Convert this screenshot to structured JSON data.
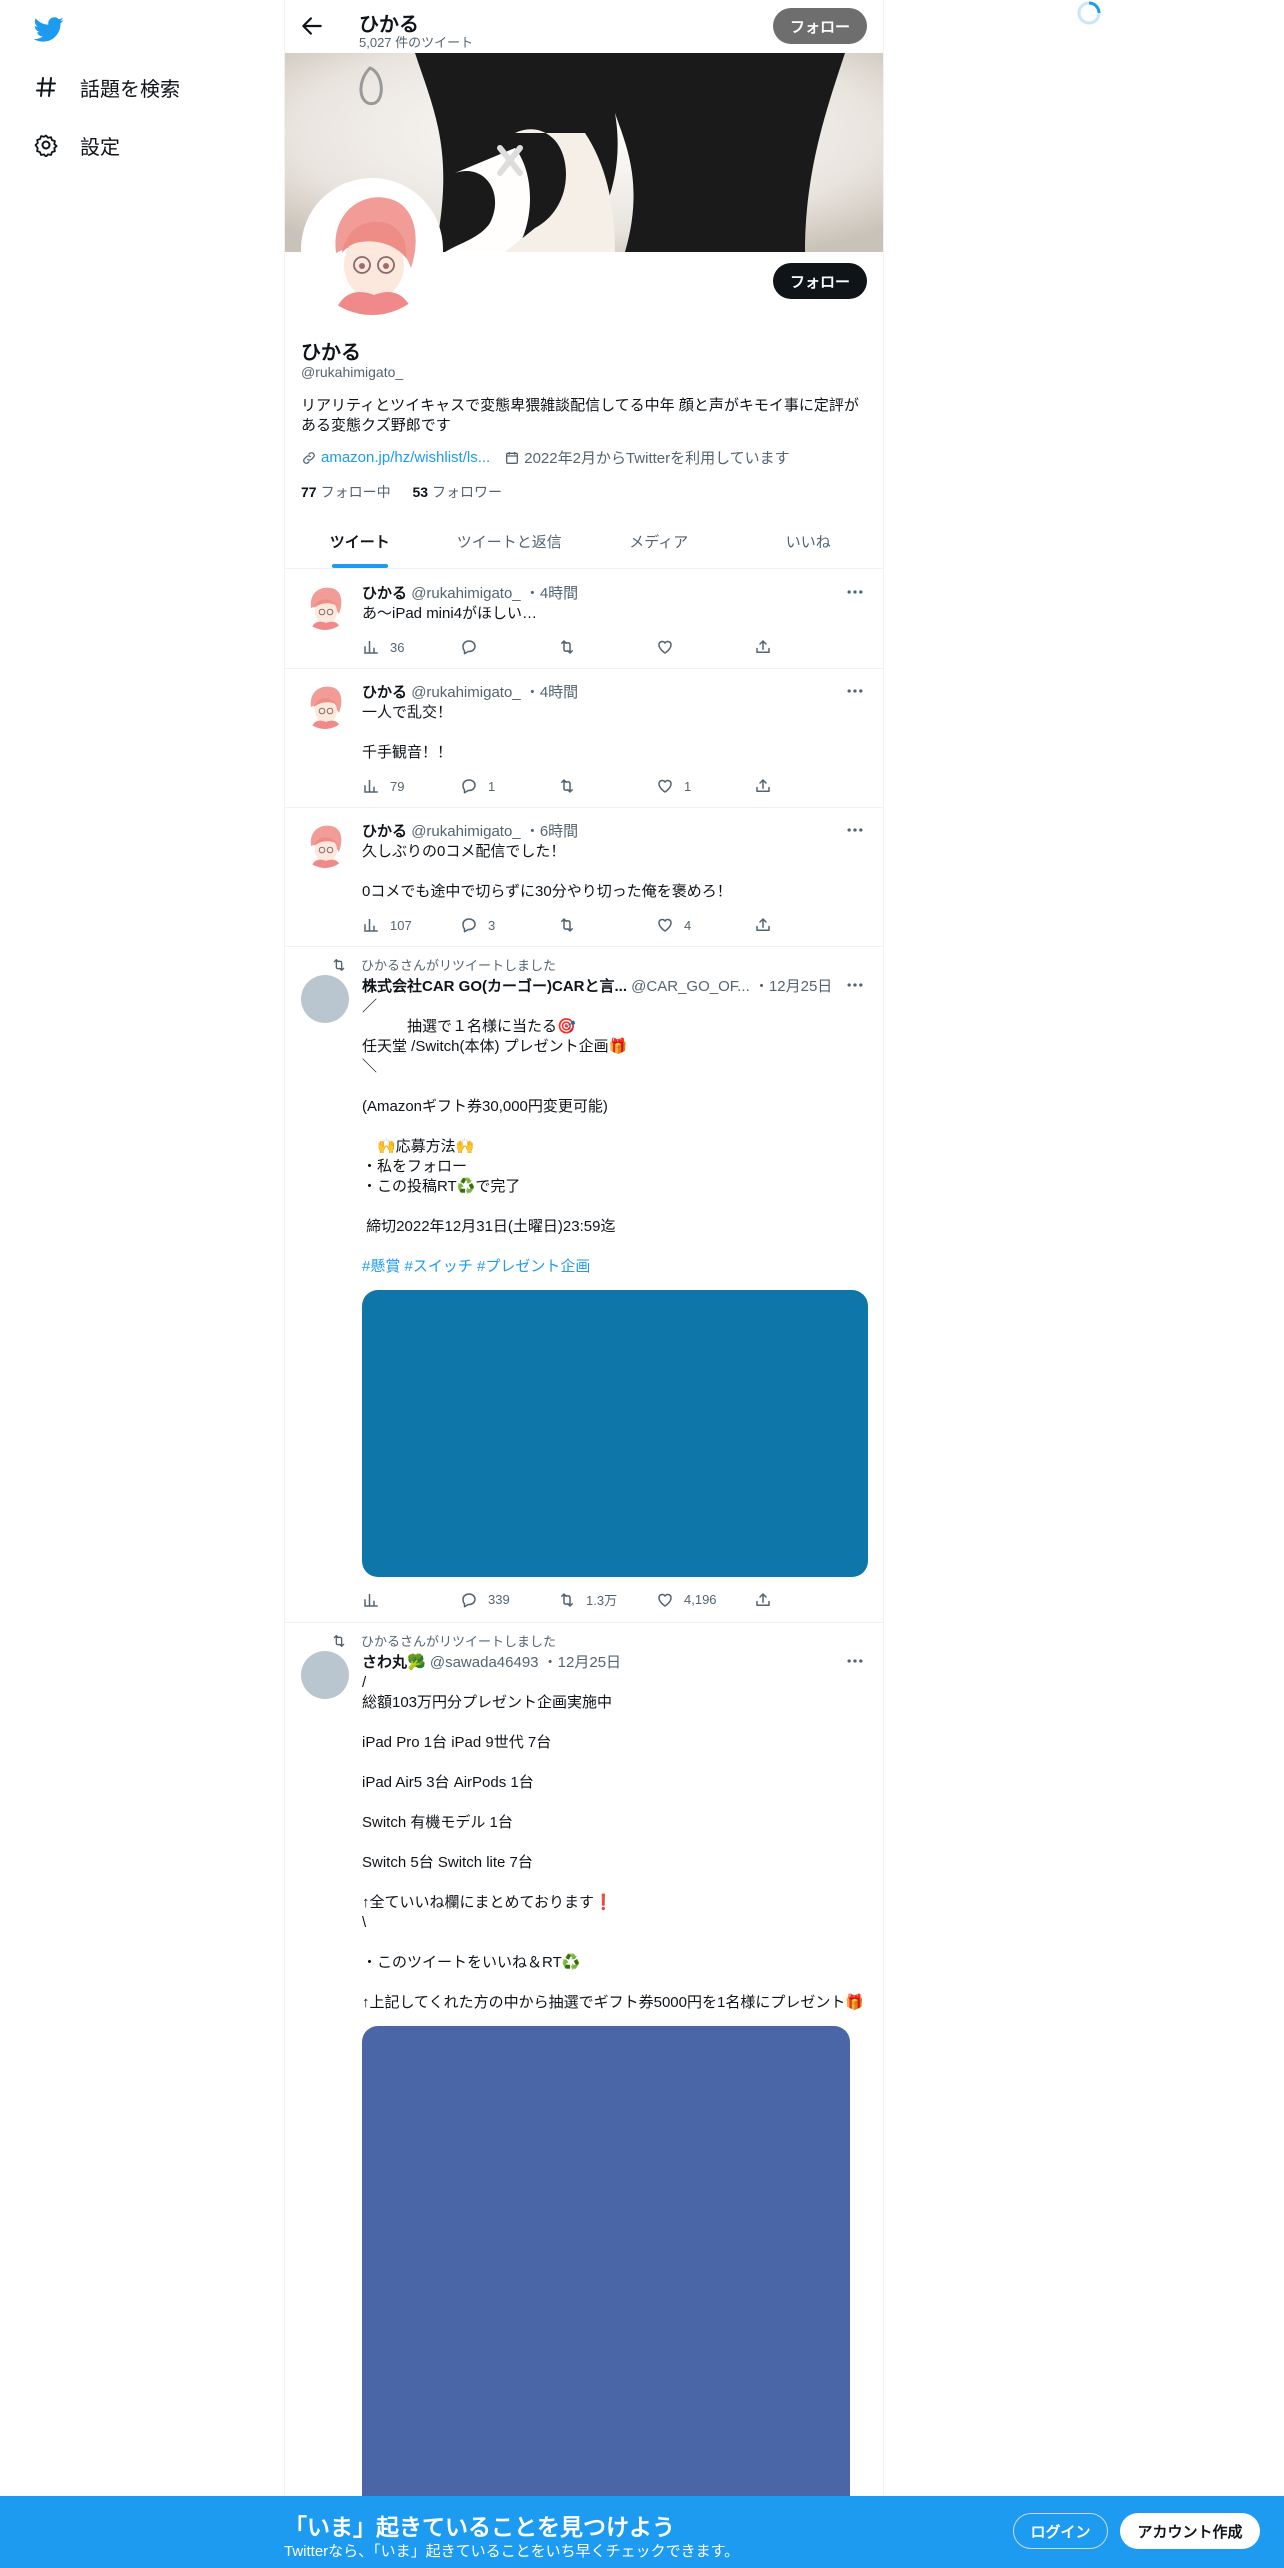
{
  "sidebar": {
    "logo": "twitter-bird-icon",
    "items": [
      {
        "label": "話題を検索",
        "icon": "hash-icon"
      },
      {
        "label": "設定",
        "icon": "gear-icon"
      }
    ]
  },
  "header": {
    "name": "ひかる",
    "tweet_count": "5,027 件のツイート",
    "follow": "フォロー"
  },
  "profile": {
    "follow": "フォロー",
    "name": "ひかる",
    "handle": "@rukahimigato_",
    "bio": "リアリティとツイキャスで変態卑猥雑談配信してる中年 顔と声がキモイ事に定評がある変態クズ野郎です",
    "link": "amazon.jp/hz/wishlist/ls...",
    "joined": "2022年2月からTwitterを利用しています",
    "following_count": "77",
    "following_label": "フォロー中",
    "followers_count": "53",
    "followers_label": "フォロワー"
  },
  "tabs": [
    "ツイート",
    "ツイートと返信",
    "メディア",
    "いいね"
  ],
  "tweets": [
    {
      "name": "ひかる",
      "handle": "@rukahimigato_",
      "time": "・4時間",
      "text": "あ〜iPad mini4がほしい…",
      "views": "36",
      "replies": "",
      "retweets": "",
      "likes": ""
    },
    {
      "name": "ひかる",
      "handle": "@rukahimigato_",
      "time": "・4時間",
      "text": "一人で乱交！\n\n千手観音！！",
      "views": "79",
      "replies": "1",
      "retweets": "",
      "likes": "1"
    },
    {
      "name": "ひかる",
      "handle": "@rukahimigato_",
      "time": "・6時間",
      "text": "久しぶりの0コメ配信でした！\n\n0コメでも途中で切らずに30分やり切った俺を褒めろ！",
      "views": "107",
      "replies": "3",
      "retweets": "",
      "likes": "4"
    },
    {
      "retweeted_by": "ひかるさんがリツイートしました",
      "name": "株式会社CAR GO(カーゴー)CARと言...",
      "handle": "@CAR_GO_OF...",
      "time": "・12月25日",
      "text": "／\n　　　抽選で１名様に当たる🎯\n任天堂 /Switch(本体) プレゼント企画🎁\n＼\n\n(Amazonギフト券30,000円変更可能)\n\n　🙌応募方法🙌\n・私をフォロー\n・この投稿RT♻️で完了\n\n 締切2022年12月31日(土曜日)23:59迄",
      "hashtags": "#懸賞 #スイッチ #プレゼント企画",
      "media_color": "#0e76a8",
      "views": "",
      "replies": "339",
      "retweets": "1.3万",
      "likes": "4,196"
    },
    {
      "retweeted_by": "ひかるさんがリツイートしました",
      "name": "さわ丸🥦",
      "handle": "@sawada46493",
      "time": "・12月25日",
      "text": "/\n総額103万円分プレゼント企画実施中\n\niPad Pro 1台 iPad 9世代 7台\n\niPad Air5 3台 AirPods 1台\n\nSwitch 有機モデル 1台\n\nSwitch 5台 Switch lite 7台\n\n↑全ていいね欄にまとめております❗\n\\\n\n・このツイートをいいね＆RT♻️\n\n↑上記してくれた方の中から抽選でギフト券5000円を1名様にプレゼント🎁",
      "media_color": "#4a66a6"
    }
  ],
  "bottom_bar": {
    "title": "「いま」起きていることを見つけよう",
    "subtitle": "Twitterなら、「いま」起きていることをいち早くチェックできます。",
    "login": "ログイン",
    "signup": "アカウント作成"
  }
}
